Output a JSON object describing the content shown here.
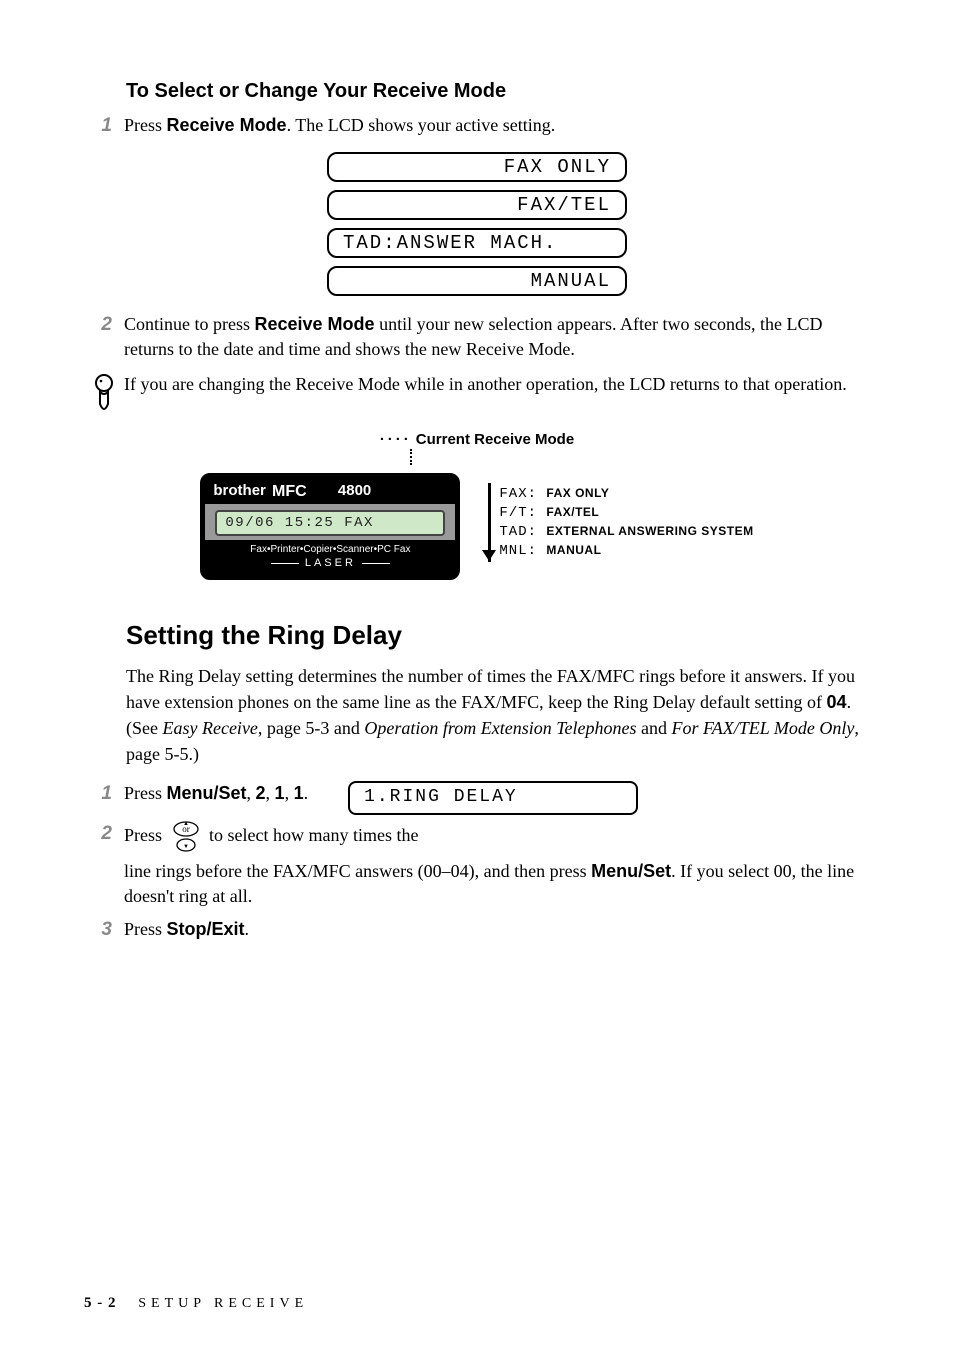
{
  "section1_title": "To Select or Change Your Receive Mode",
  "s1_step1_num": "1",
  "s1_step1_a": "Press ",
  "s1_step1_b": "Receive Mode",
  "s1_step1_c": ". The LCD shows your active setting.",
  "lcd_modes": {
    "m1": "FAX ONLY",
    "m2": "FAX/TEL",
    "m3": "TAD:ANSWER MACH.",
    "m4": "MANUAL"
  },
  "s1_step2_num": "2",
  "s1_step2_a": "Continue to press ",
  "s1_step2_b": "Receive Mode",
  "s1_step2_c": " until your new selection appears. After two seconds, the LCD returns to the date and time and shows the new Receive Mode.",
  "note_text": "If you are changing the Receive Mode while in another operation, the LCD returns to that operation.",
  "current_caption": "Current Receive Mode",
  "device": {
    "brand": "brother",
    "model": "4800",
    "screen": "09/06 15:25  FAX",
    "subline": "Fax•Printer•Copier•Scanner•PC Fax",
    "laser": "LASER"
  },
  "legend": {
    "l1k": "FAX",
    "l1v": "FAX ONLY",
    "l2k": "F/T",
    "l2v": "FAX/TEL",
    "l3k": "TAD",
    "l3v": "EXTERNAL ANSWERING SYSTEM",
    "l4k": "MNL",
    "l4v": "MANUAL"
  },
  "section2_title": "Setting the Ring Delay",
  "s2_para_a": "The Ring Delay setting determines the number of times the FAX/MFC rings before it answers.  If you have extension phones on the same line as the FAX/MFC, keep the Ring Delay default setting of ",
  "s2_para_b": "04",
  "s2_para_c": ". (See ",
  "s2_para_d": "Easy Receive",
  "s2_para_e": ", page 5-3 and ",
  "s2_para_f": "Operation from Extension Telephones",
  "s2_para_g": " and ",
  "s2_para_h": "For FAX/TEL Mode Only",
  "s2_para_i": ", page 5-5.)",
  "s2_step1_num": "1",
  "s2_step1_a": "Press ",
  "s2_step1_b": "Menu/Set",
  "s2_step1_c": ", ",
  "s2_step1_d": "2",
  "s2_step1_e": ", ",
  "s2_step1_f": "1",
  "s2_step1_g": ", ",
  "s2_step1_h": "1",
  "s2_step1_i": ".",
  "s2_lcd": "1.RING DELAY",
  "s2_step2_num": "2",
  "s2_step2_a": "Press ",
  "s2_step2_or": "or",
  "s2_step2_b": " to select how many times the",
  "s2_step2_c": "line rings before the FAX/MFC answers (00–04), and then press ",
  "s2_step2_d": "Menu/Set",
  "s2_step2_e": ". If you select 00, the line doesn't ring at all.",
  "s2_step3_num": "3",
  "s2_step3_a": "Press ",
  "s2_step3_b": "Stop/Exit",
  "s2_step3_c": ".",
  "footer_page": "5 - 2",
  "footer_chapter": "SETUP RECEIVE"
}
